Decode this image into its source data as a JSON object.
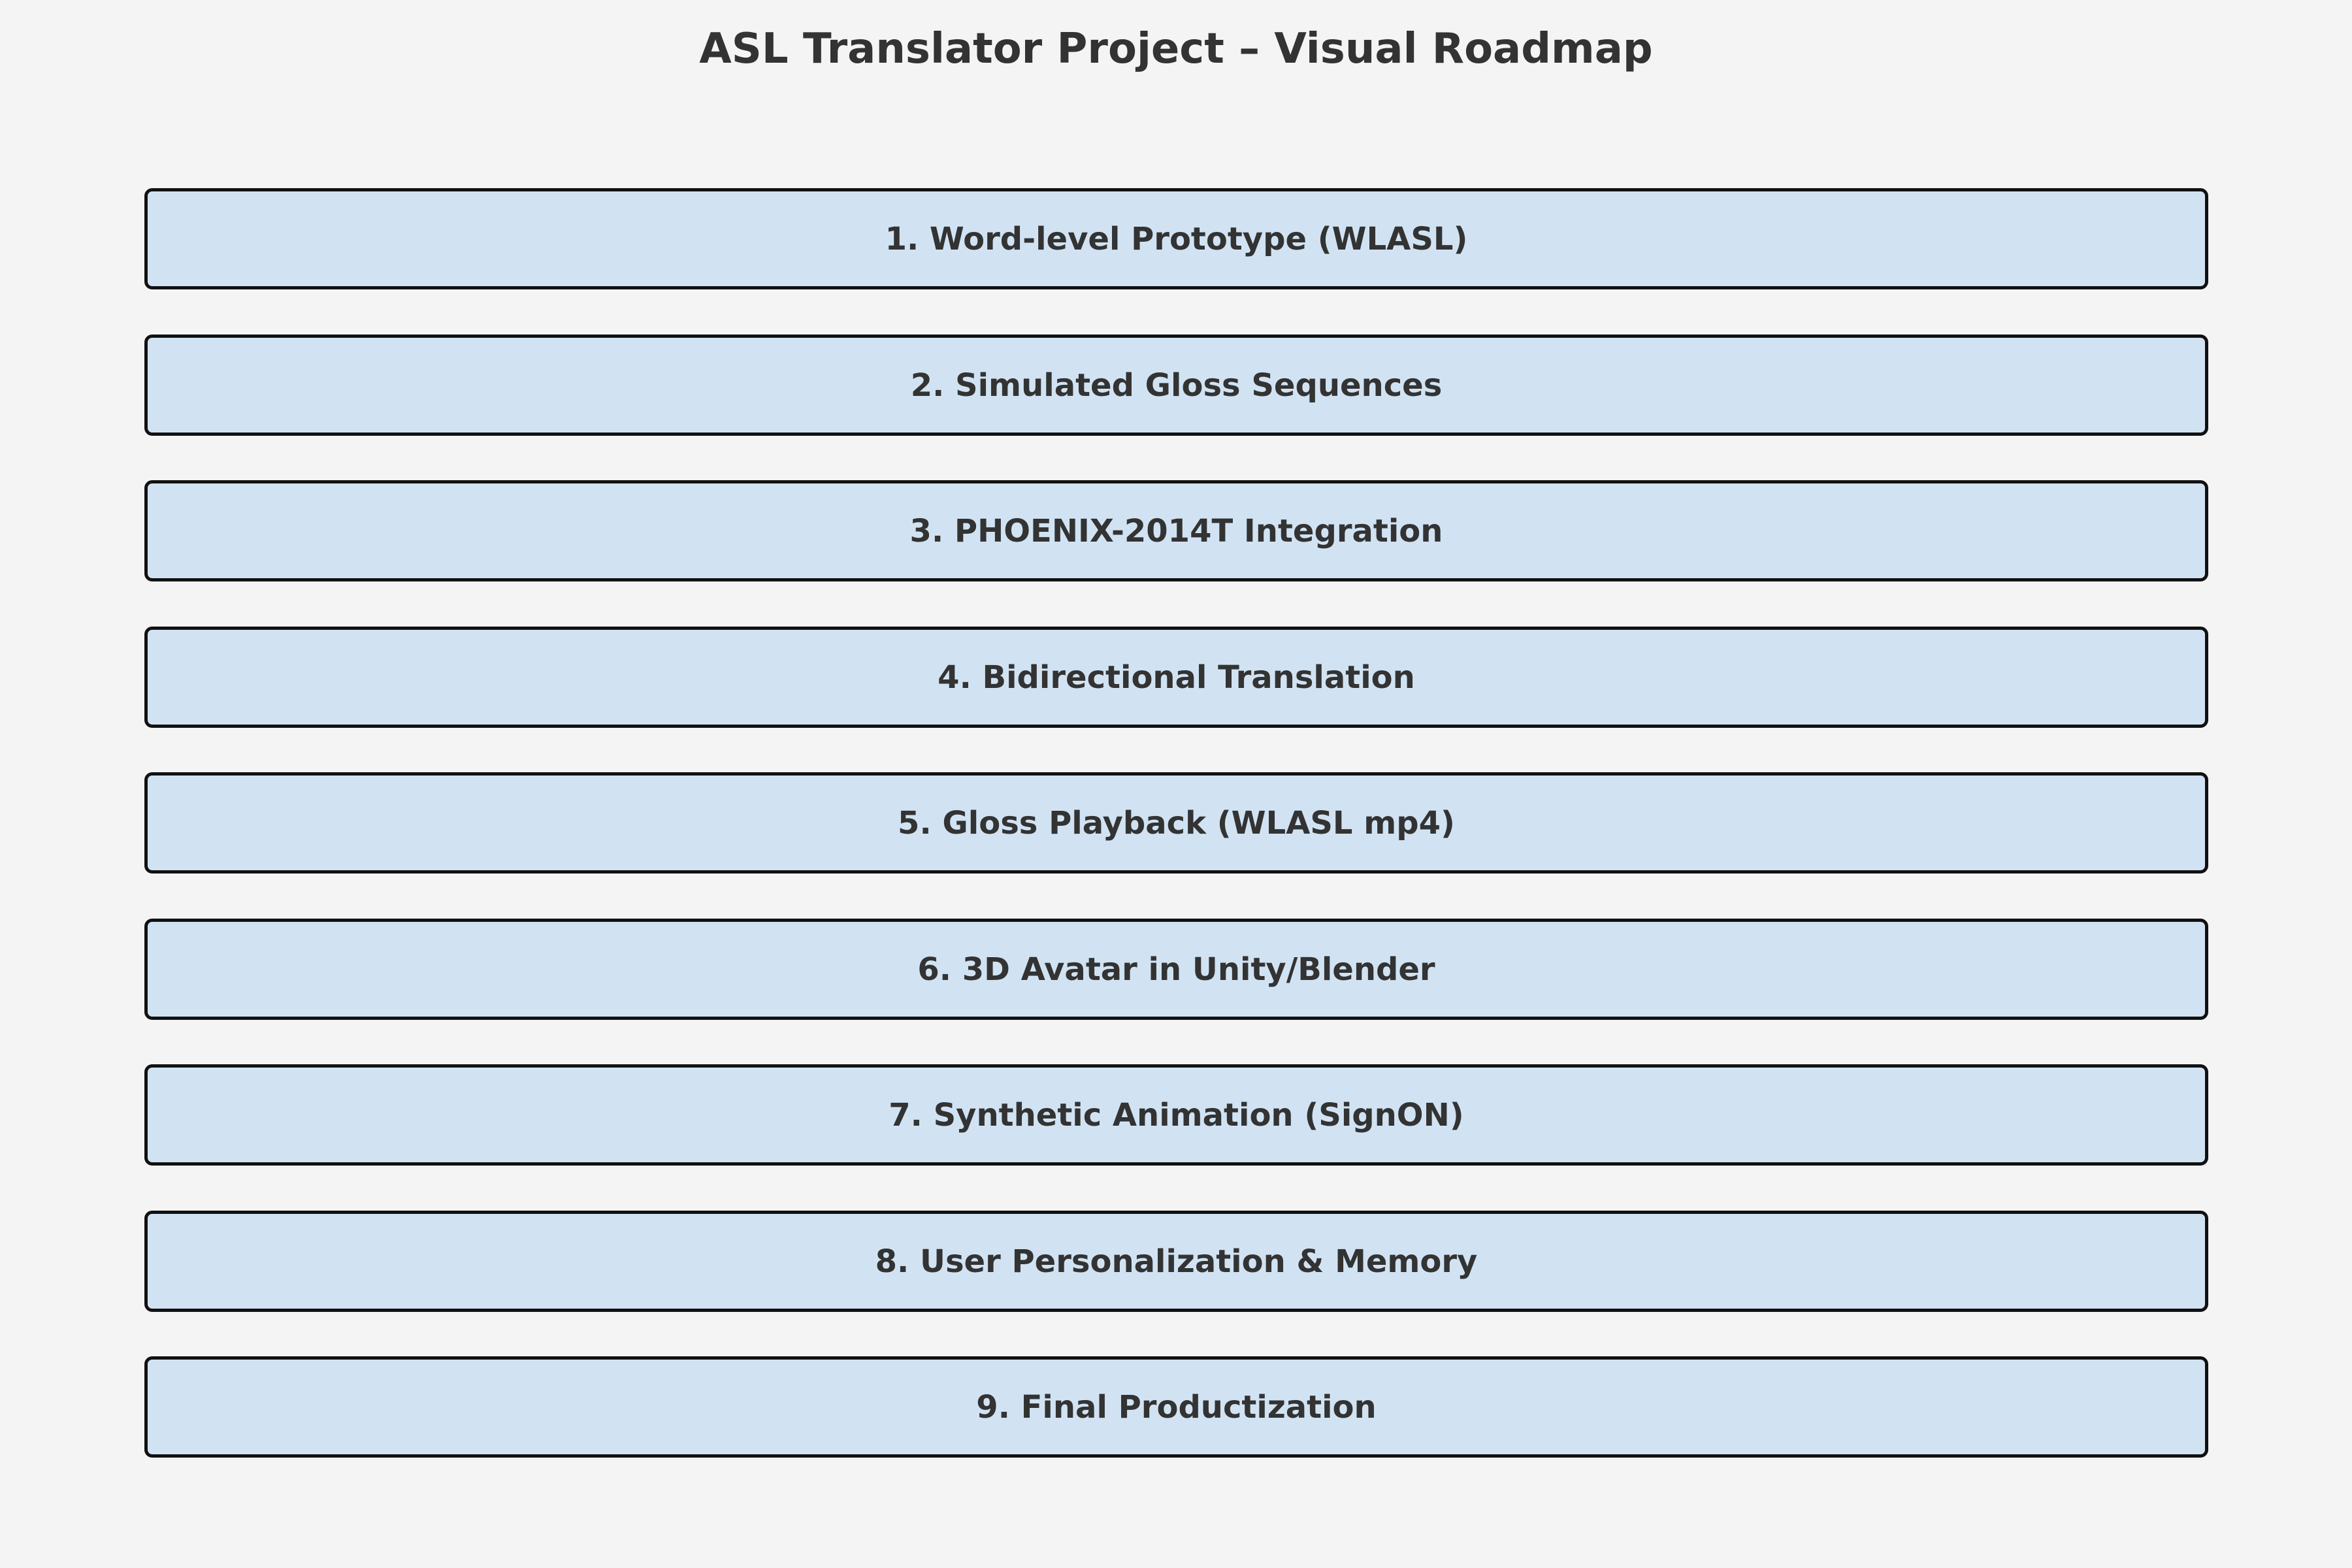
{
  "title": "ASL Translator Project – Visual Roadmap",
  "colors": {
    "background": "#f4f4f4",
    "step_fill": "#d1e3f3",
    "step_border": "#111111",
    "text": "#333333"
  },
  "steps": [
    "1. Word-level Prototype (WLASL)",
    "2. Simulated Gloss Sequences",
    "3. PHOENIX-2014T Integration",
    "4. Bidirectional Translation",
    "5. Gloss Playback (WLASL mp4)",
    "6. 3D Avatar in Unity/Blender",
    "7. Synthetic Animation (SignON)",
    "8. User Personalization & Memory",
    "9. Final Productization"
  ]
}
